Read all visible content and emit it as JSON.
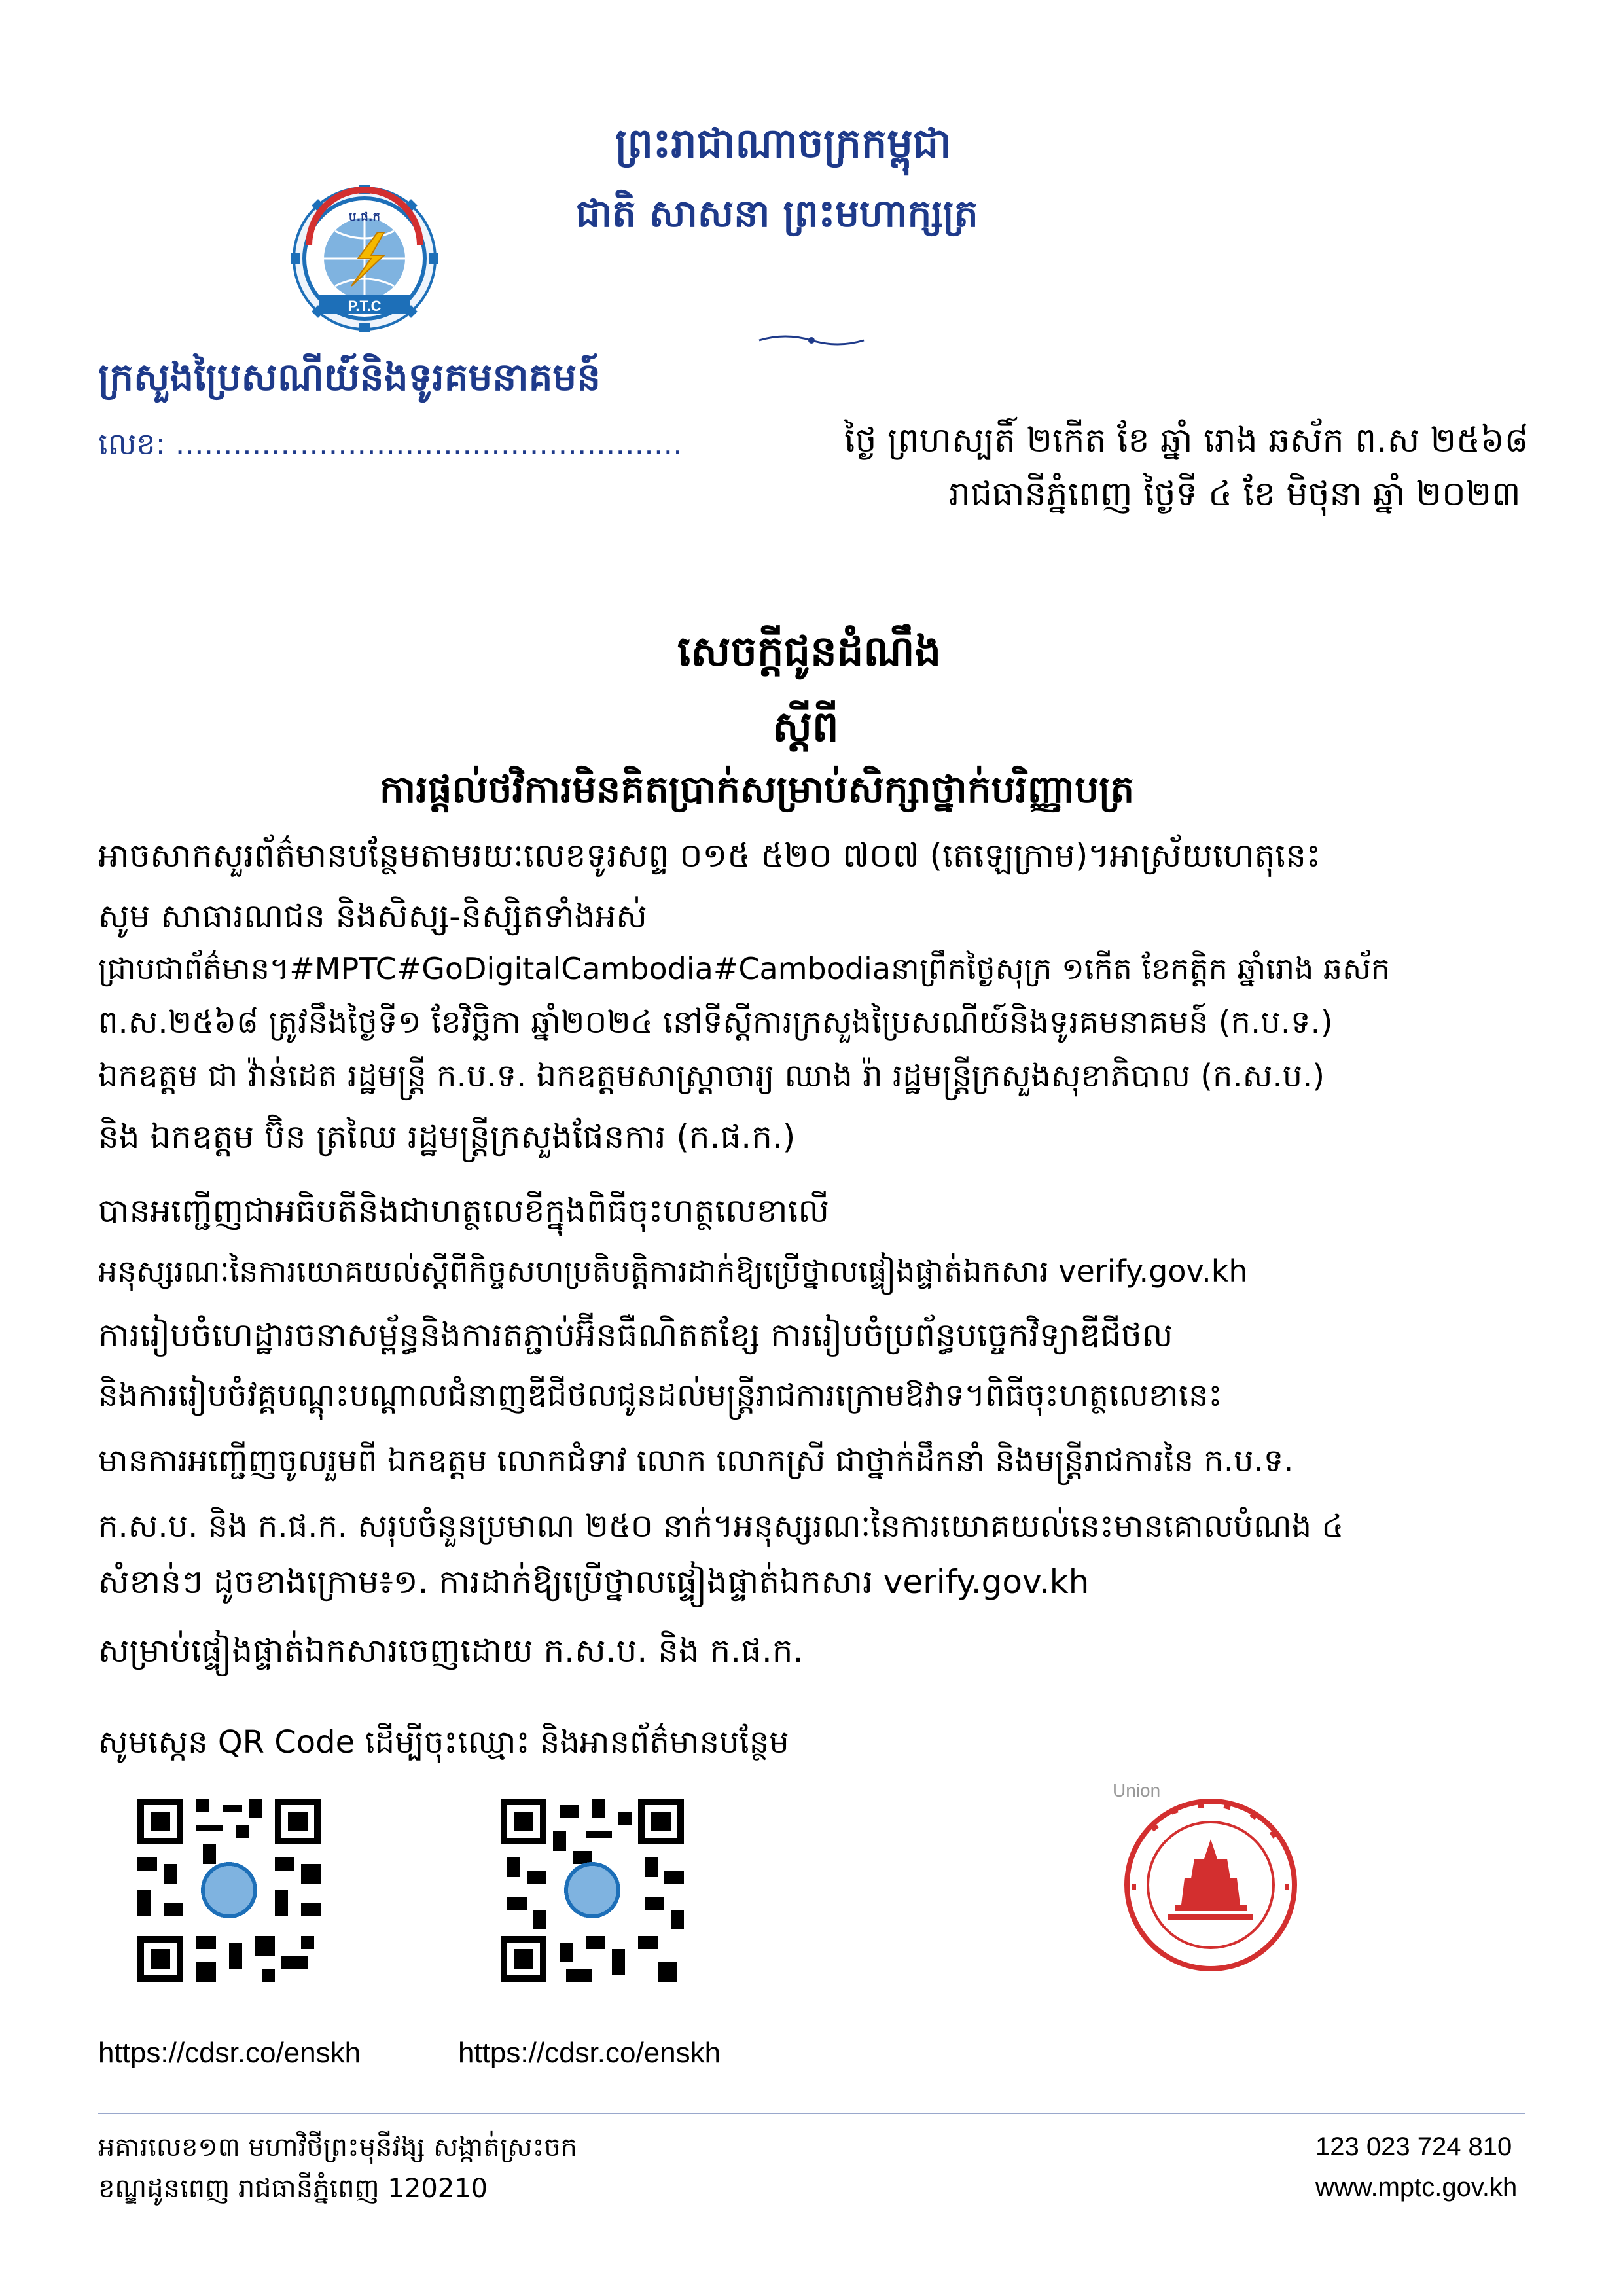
{
  "header": {
    "kingdom": "ព្រះរាជាណាចក្រកម្ពុជា",
    "motto": "ជាតិ សាសនា ព្រះមហាក្សត្រ",
    "ministry": "ក្រសួងប្រៃសណីយ៍និងទូរគមនាគមន៍",
    "ref_no": "លេខ: .....................................................",
    "lunar_date": "ថ្ងៃ ព្រហស្បតិ៍ ២កើត ខែ ឆ្នាំ រោង ឆស័ក ព.ស ២៥៦៨",
    "city_date": "រាជធានីភ្នំពេញ ថ្ងៃទី ៤ ខែ មិថុនា ឆ្នាំ ២០២៣",
    "logo_text": "P.T.C",
    "logo_top": "ប.ផ.ក"
  },
  "title": {
    "line1": "សេចក្តីជូនដំណឹង",
    "line2": "ស្តីពី",
    "line3": "ការផ្តល់ថវិការមិនគិតប្រាក់សម្រាប់សិក្សាថ្នាក់បរិញ្ញាបត្រ"
  },
  "body": [
    "អាចសាកសួរព័ត៌មានបន្ថែមតាមរយៈលេខទូរសព្ទ ០១៥ ៥២០ ៧០៧ (តេឡេក្រាម)។អាស្រ័យហេតុនេះ",
    "សូម សាធារណជន និងសិស្ស-និស្សិតទាំងអស់",
    "ជ្រាបជាព័ត៌មាន។#MPTC#GoDigitalCambodia#Cambodiaនាព្រឹកថ្ងៃសុក្រ ១កើត ខែកត្តិក ឆ្នាំរោង ឆស័ក",
    "ព.ស.២៥៦៨ ត្រូវនឹងថ្ងៃទី១ ខែវិច្ឆិកា ឆ្នាំ២០២៤ នៅទីស្តីការក្រសួងប្រៃសណីយ៍និងទូរគមនាគមន៍ (ក.ប.ទ.)",
    "ឯកឧត្តម ជា វ៉ាន់ដេត រដ្ឋមន្រ្តី ក.ប.ទ. ឯកឧត្តមសាស្ត្រាចារ្យ ឈាង រ៉ា រដ្ឋមន្ត្រីក្រសួងសុខាភិបាល (ក.ស.ប.)",
    "និង ឯកឧត្តម ប៊ិន ត្រឈៃ រដ្ឋមន្ត្រីក្រសួងផែនការ (ក.ផ.ក.)",
    "បានអញ្ជើញជាអធិបតីនិងជាហត្ថលេខីក្នុងពិធីចុះហត្ថលេខាលើ",
    "អនុស្សរណៈនៃការយោគយល់ស្តីពីកិច្ចសហប្រតិបត្តិការដាក់ឱ្យប្រើថ្នាលផ្ទៀងផ្ទាត់ឯកសារ verify.gov.kh",
    "ការរៀបចំហេដ្ឋារចនាសម្ព័ន្ធនិងការតភ្ជាប់អ៊ីនធឺណិតតខ្សែ ការរៀបចំប្រព័ន្ធបច្ចេកវិទ្យាឌីជីថល",
    "និងការរៀបចំវគ្គបណ្តុះបណ្តាលជំនាញឌីជីថលជូនដល់មន្ត្រីរាជការក្រោមឱវាទ។ពិធីចុះហត្ថលេខានេះ",
    "មានការអញ្ជើញចូលរួមពី ឯកឧត្តម លោកជំទាវ លោក លោកស្រី ជាថ្នាក់ដឹកនាំ និងមន្ត្រីរាជការនៃ ក.ប.ទ.",
    "ក.ស.ប. និង ក.ផ.ក. សរុបចំនួនប្រមាណ ២៥០ នាក់។អនុស្សរណៈនៃការយោគយល់នេះមានគោលបំណង ៤",
    "សំខាន់ៗ ដូចខាងក្រោម៖១. ការដាក់ឱ្យប្រើថ្នាលផ្ទៀងផ្ទាត់ឯកសារ verify.gov.kh",
    "សម្រាប់ផ្ទៀងផ្ទាត់ឯកសារចេញដោយ ក.ស.ប. និង ក.ផ.ក."
  ],
  "qr_prompt": "សូមស្កេន QR Code ដើម្បីចុះឈ្មោះ និងអានព័ត៌មានបន្ថែម",
  "links": [
    "https://cdsr.co/enskh",
    "https://cdsr.co/enskh"
  ],
  "stamp_text": "Union",
  "footer": {
    "address1": "អគារលេខ១៣ មហាវិថីព្រះមុនីវង្ស សង្កាត់ស្រះចក",
    "address2": "ខណ្ឌដូនពេញ រាជធានីភ្នំពេញ 120210",
    "phone": "123   023 724 810",
    "website": "www.mptc.gov.kh"
  },
  "colors": {
    "navy": "#1e3a8a",
    "stamp_red": "#d32f2f",
    "logo_blue": "#1d6fb8"
  }
}
